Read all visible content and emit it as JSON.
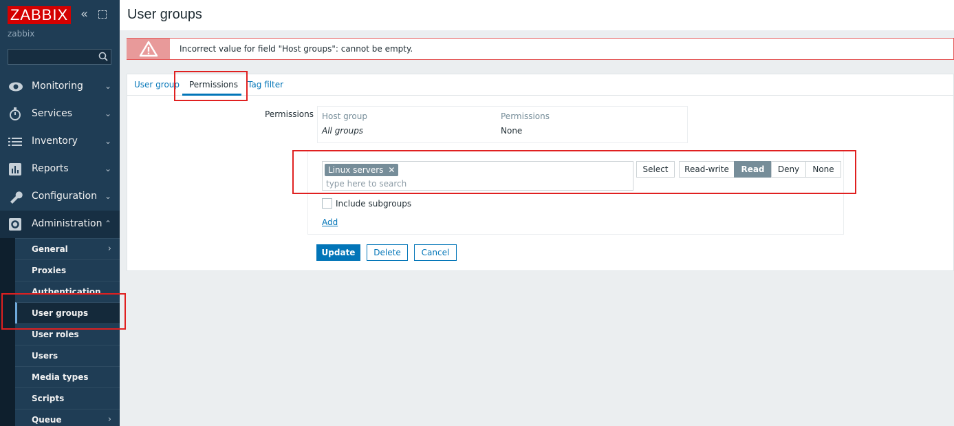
{
  "app": {
    "logo": "ZABBIX",
    "server_name": "zabbix"
  },
  "sidebar": {
    "nav": [
      {
        "label": "Monitoring",
        "icon": "eye-icon"
      },
      {
        "label": "Services",
        "icon": "stopwatch-icon"
      },
      {
        "label": "Inventory",
        "icon": "list-icon"
      },
      {
        "label": "Reports",
        "icon": "bar-chart-icon"
      },
      {
        "label": "Configuration",
        "icon": "wrench-icon"
      },
      {
        "label": "Administration",
        "icon": "gear-icon"
      }
    ],
    "submenu": [
      "General",
      "Proxies",
      "Authentication",
      "User groups",
      "User roles",
      "Users",
      "Media types",
      "Scripts",
      "Queue"
    ],
    "selected_submenu": "User groups"
  },
  "page": {
    "title": "User groups"
  },
  "message": {
    "text": "Incorrect value for field \"Host groups\": cannot be empty."
  },
  "tabs": [
    "User group",
    "Permissions",
    "Tag filter"
  ],
  "active_tab": "Permissions",
  "form": {
    "permissions_label": "Permissions",
    "table": {
      "headers": [
        "Host group",
        "Permissions"
      ],
      "rows": [
        {
          "group": "All groups",
          "permission": "None"
        }
      ]
    },
    "multiselect": {
      "chip": "Linux servers",
      "placeholder": "type here to search"
    },
    "select_button": "Select",
    "levels": [
      "Read-write",
      "Read",
      "Deny",
      "None"
    ],
    "selected_level": "Read",
    "include_subgroups": "Include subgroups",
    "add_link": "Add",
    "buttons": {
      "update": "Update",
      "delete": "Delete",
      "cancel": "Cancel"
    }
  },
  "colors": {
    "sidebar": "#1f3d55",
    "logo": "#d40000",
    "link": "#0275b8",
    "error": "#e45959",
    "highlight": "#e02020"
  }
}
